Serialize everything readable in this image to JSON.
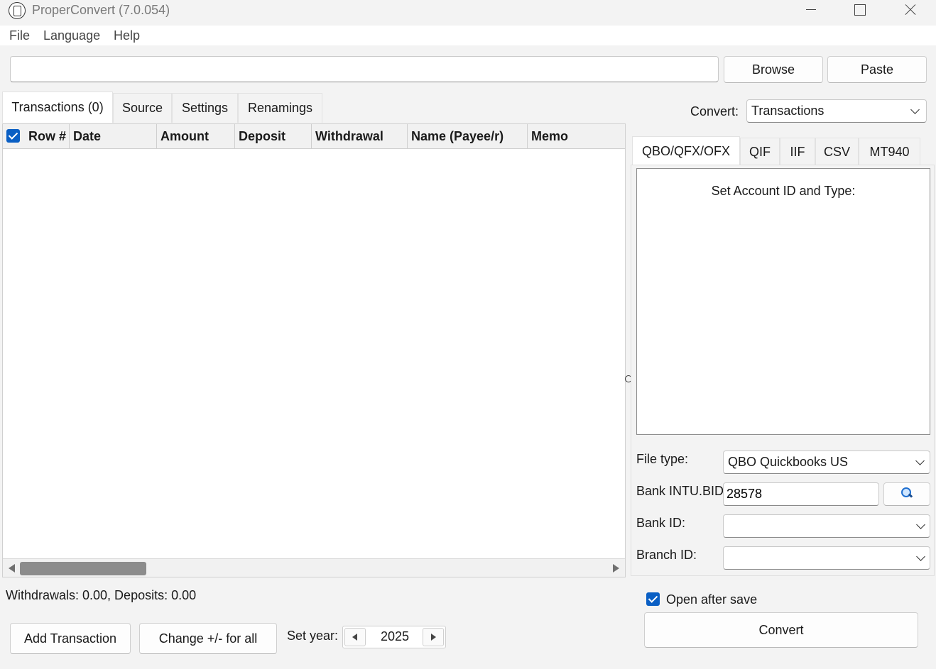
{
  "window": {
    "title": "ProperConvert (7.0.054)"
  },
  "menu": {
    "file": "File",
    "language": "Language",
    "help": "Help"
  },
  "path_bar": {
    "value": "",
    "browse_label": "Browse",
    "paste_label": "Paste"
  },
  "tabs": {
    "transactions": "Transactions (0)",
    "source": "Source",
    "settings": "Settings",
    "renamings": "Renamings"
  },
  "grid": {
    "select_all_checked": true,
    "columns": [
      "Row #",
      "Date",
      "Amount",
      "Deposit",
      "Withdrawal",
      "Name (Payee/r)",
      "Memo"
    ],
    "rows": []
  },
  "status": {
    "totals": "Withdrawals: 0.00, Deposits: 0.00"
  },
  "actions": {
    "add_transaction": "Add Transaction",
    "change_sign": "Change +/- for all",
    "set_year_label": "Set year:",
    "year": "2025"
  },
  "convert": {
    "label": "Convert:",
    "selected": "Transactions",
    "format_tabs": [
      "QBO/QFX/OFX",
      "QIF",
      "IIF",
      "CSV",
      "MT940"
    ],
    "panel_title": "Set Account ID and Type:",
    "file_type_label": "File type:",
    "file_type_value": "QBO Quickbooks US",
    "bank_intu_label": "Bank INTU.BID:",
    "bank_intu_value": "28578",
    "bank_id_label": "Bank ID:",
    "bank_id_value": "",
    "branch_id_label": "Branch ID:",
    "branch_id_value": "",
    "open_after_save_label": "Open after save",
    "open_after_save_checked": true,
    "convert_button": "Convert"
  },
  "colors": {
    "accent": "#0a5fc4",
    "window_bg": "#f3f3f3",
    "panel_bg": "#ffffff"
  }
}
